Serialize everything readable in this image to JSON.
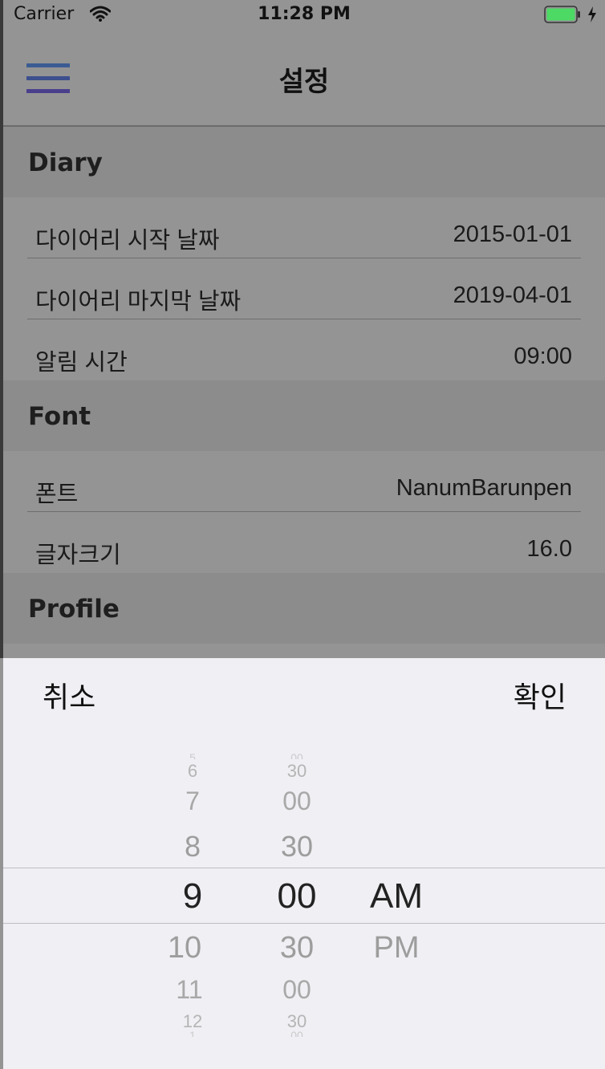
{
  "status_bar": {
    "carrier": "Carrier",
    "time": "11:28 PM",
    "battery_color": "#4cd964"
  },
  "nav": {
    "title": "설정"
  },
  "sections": [
    {
      "title": "Diary",
      "rows": [
        {
          "label": "다이어리 시작 날짜",
          "value": "2015-01-01"
        },
        {
          "label": "다이어리 마지막 날짜",
          "value": "2019-04-01"
        },
        {
          "label": "알림 시간",
          "value": "09:00"
        }
      ]
    },
    {
      "title": "Font",
      "rows": [
        {
          "label": "폰트",
          "value": "NanumBarunpen"
        },
        {
          "label": "글자크기",
          "value": "16.0"
        }
      ]
    },
    {
      "title": "Profile",
      "rows": []
    }
  ],
  "picker": {
    "cancel_label": "취소",
    "confirm_label": "확인",
    "hours": [
      "5",
      "6",
      "7",
      "8",
      "9",
      "10",
      "11",
      "12",
      "1"
    ],
    "minutes": [
      "00",
      "30",
      "00",
      "30",
      "00",
      "30",
      "00",
      "30",
      "00"
    ],
    "ampm": [
      "AM",
      "PM"
    ],
    "selected": {
      "hour": "9",
      "minute": "00",
      "ampm": "AM"
    }
  }
}
